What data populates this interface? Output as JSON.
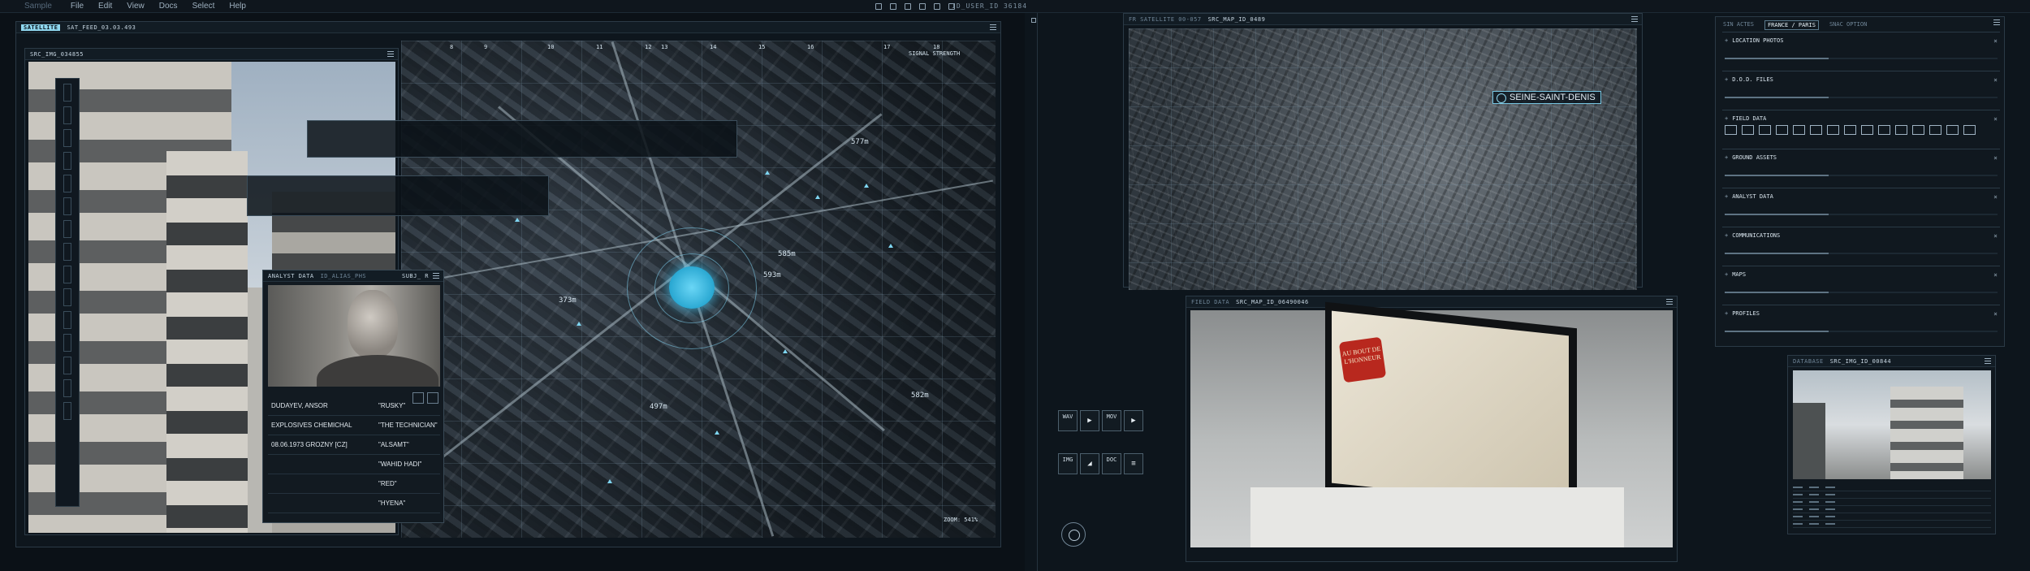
{
  "menubar": {
    "brand": "Sample",
    "items": [
      "File",
      "Edit",
      "View",
      "Docs",
      "Select",
      "Help"
    ],
    "clock": "ID_USER_ID 36184"
  },
  "left_window": {
    "tag": "SATELLITE",
    "title": "SAT_FEED_03.03.493",
    "photo_title": "SRC_IMG_034855",
    "signal_label": "SIGNAL STRENGTH",
    "zoom_label": "ZOOM: 541%",
    "grid_numbers": [
      "8",
      "9",
      "10",
      "11",
      "12",
      "13",
      "14",
      "15",
      "16",
      "17",
      "18"
    ],
    "distances": [
      "577m",
      "373m",
      "582m",
      "497m",
      "585m",
      "593m"
    ]
  },
  "analyst": {
    "title": "ANALYST DATA",
    "id": "ID_ALIAS_PHS",
    "sub": "SUBJ_ R",
    "rows": [
      {
        "left": "DUDAYEV, ANSOR",
        "right": "\"RUSKY\""
      },
      {
        "left": "EXPLOSIVES CHEMICHAL",
        "right": "\"THE TECHNICIAN\""
      },
      {
        "left": "08.06.1973 GROZNY [CZ]",
        "right": "\"ALSAMT\""
      },
      {
        "left": "",
        "right": "\"WAHID HADI\""
      },
      {
        "left": "",
        "right": "\"RED\""
      },
      {
        "left": "",
        "right": "\"HYENA\""
      }
    ]
  },
  "sat_map": {
    "tag": "FR SATELLITE 00-057",
    "title": "SRC_MAP_ID_0489",
    "place": "SEINE-SAINT-DENIS"
  },
  "field_data": {
    "tag": "FIELD DATA",
    "title": "SRC_MAP_ID_06490046",
    "poster_text": "AU BOUT DE L'HONNEUR"
  },
  "options": {
    "tabs": [
      "SIN ACTES",
      "FRANCE / PARIS",
      "SNAC OPTION"
    ],
    "sections": [
      {
        "label": "LOCATION PHOTOS",
        "prefix": "+"
      },
      {
        "label": "D.O.D. FILES",
        "prefix": "+"
      },
      {
        "label": "FIELD DATA",
        "prefix": "+"
      },
      {
        "label": "GROUND ASSETS",
        "prefix": "+"
      },
      {
        "label": "ANALYST DATA",
        "prefix": "+"
      },
      {
        "label": "COMMUNICATIONS",
        "prefix": "+"
      },
      {
        "label": "MAPS",
        "prefix": "+"
      },
      {
        "label": "PROFILES",
        "prefix": "+"
      }
    ]
  },
  "media": {
    "wav": "WAV",
    "mov": "MOV",
    "img": "IMG",
    "doc": "DOC"
  },
  "database": {
    "tag": "DATABASE",
    "title": "SRC_IMG_ID_00844"
  },
  "colors": {
    "accent": "#8fd7ef",
    "bg": "#0b1117",
    "panel": "#0e161d"
  }
}
